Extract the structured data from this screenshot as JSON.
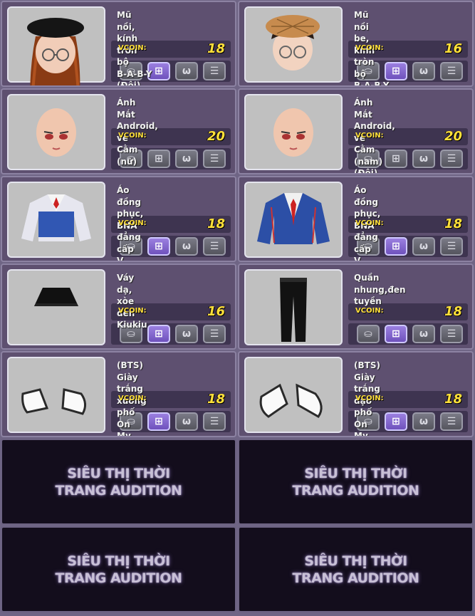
{
  "shop": {
    "currency_label": "VCOIN:",
    "items": [
      {
        "name": "Mũ nồi, kính tròn bộ B-A-B-Y (Đôi)",
        "price": "18",
        "icon": "beret-glasses-girl-hair"
      },
      {
        "name": "Mũ nồi be, kính tròn bộ B-A-B-Y",
        "price": "16",
        "icon": "beige-beret-glasses-boy-hair"
      },
      {
        "name": "Ánh Mắt Android, vẽ Cằm (nữ)",
        "price": "20",
        "icon": "female-face-eyes"
      },
      {
        "name": "Ánh Mắt Android, vẽ Cằm (nam) (Đôi)",
        "price": "20",
        "icon": "male-face-eyes"
      },
      {
        "name": "Áo đồng phục, BNA đẳng cấp V",
        "price": "18",
        "icon": "vest-uniform-shirt"
      },
      {
        "name": "Áo đồng phục, BNA đẳng cấp V",
        "price": "18",
        "icon": "blue-blazer-uniform"
      },
      {
        "name": "Váy dạ, xòe đen Kiukiu",
        "price": "16",
        "icon": "black-skirt"
      },
      {
        "name": "Quần nhung,đen tuyền",
        "price": "18",
        "icon": "black-pants"
      },
      {
        "name": "(BTS) Giày trắng xuống phố On My Street",
        "price": "18",
        "icon": "white-shoes"
      },
      {
        "name": "(BTS) Giày trắng dạo phố On My Street",
        "price": "18",
        "icon": "white-shoes"
      }
    ],
    "buttons": [
      "gift-icon",
      "buy-box-icon",
      "preview-icon",
      "cart-icon"
    ]
  },
  "promo": {
    "text": "SIÊU THỊ THỜI\nTRANG AUDITION"
  }
}
